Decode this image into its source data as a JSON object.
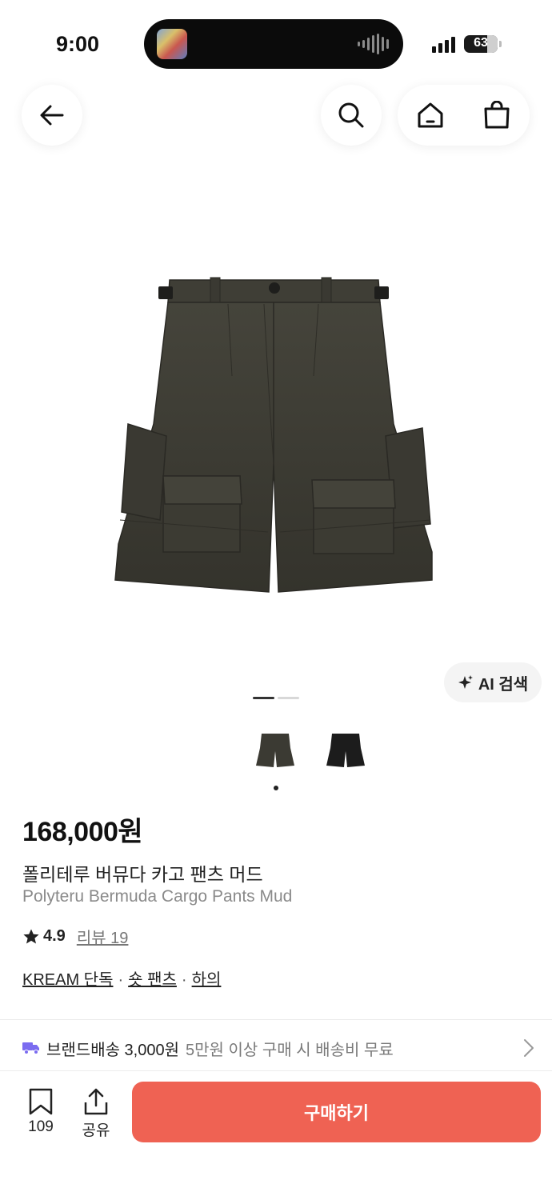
{
  "status_bar": {
    "time": "9:00",
    "battery": "63"
  },
  "header": {
    "back": "back",
    "search": "search",
    "home": "home",
    "cart": "shopping-bag"
  },
  "product": {
    "ai_search_label": "AI 검색",
    "image_count": 2,
    "current_image": 1,
    "colors": {
      "mud": "#3b3a33",
      "black": "#1c1c1c"
    },
    "price": "168,000원",
    "name_ko": "폴리테루 버뮤다 카고 팬츠 머드",
    "name_en": "Polyteru Bermuda Cargo Pants Mud",
    "rating": "4.9",
    "review_text": "리뷰 19",
    "tags": [
      "KREAM 단독",
      "숏 팬츠",
      "하의"
    ]
  },
  "shipping": {
    "label": "브랜드배송 3,000원",
    "note": "5만원 이상 구매 시 배송비 무료"
  },
  "bottom_bar": {
    "bookmark_count": "109",
    "share_label": "공유",
    "buy_label": "구매하기"
  },
  "colors": {
    "accent": "#ef6253",
    "shipping_icon": "#7b6cf0"
  }
}
